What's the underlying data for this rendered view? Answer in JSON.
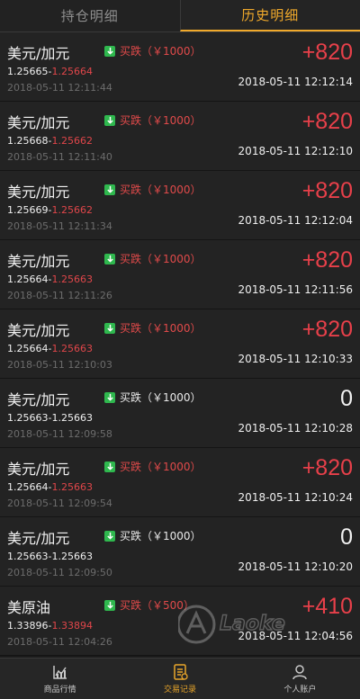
{
  "tabs": [
    {
      "label": "持仓明细",
      "active": false
    },
    {
      "label": "历史明细",
      "active": true
    }
  ],
  "trades": [
    {
      "symbol": "美元/加元",
      "direction": "买跌（￥1000）",
      "open_price": "1.25665",
      "close_price": "1.25664",
      "open_time": "2018-05-11 12:11:44",
      "pnl": "+820",
      "close_time": "2018-05-11 12:12:14",
      "win": true
    },
    {
      "symbol": "美元/加元",
      "direction": "买跌（￥1000）",
      "open_price": "1.25668",
      "close_price": "1.25662",
      "open_time": "2018-05-11 12:11:40",
      "pnl": "+820",
      "close_time": "2018-05-11 12:12:10",
      "win": true
    },
    {
      "symbol": "美元/加元",
      "direction": "买跌（￥1000）",
      "open_price": "1.25669",
      "close_price": "1.25662",
      "open_time": "2018-05-11 12:11:34",
      "pnl": "+820",
      "close_time": "2018-05-11 12:12:04",
      "win": true
    },
    {
      "symbol": "美元/加元",
      "direction": "买跌（￥1000）",
      "open_price": "1.25664",
      "close_price": "1.25663",
      "open_time": "2018-05-11 12:11:26",
      "pnl": "+820",
      "close_time": "2018-05-11 12:11:56",
      "win": true
    },
    {
      "symbol": "美元/加元",
      "direction": "买跌（￥1000）",
      "open_price": "1.25664",
      "close_price": "1.25663",
      "open_time": "2018-05-11 12:10:03",
      "pnl": "+820",
      "close_time": "2018-05-11 12:10:33",
      "win": true
    },
    {
      "symbol": "美元/加元",
      "direction": "买跌（￥1000）",
      "open_price": "1.25663",
      "close_price": "1.25663",
      "open_time": "2018-05-11 12:09:58",
      "pnl": "0",
      "close_time": "2018-05-11 12:10:28",
      "win": false
    },
    {
      "symbol": "美元/加元",
      "direction": "买跌（￥1000）",
      "open_price": "1.25664",
      "close_price": "1.25663",
      "open_time": "2018-05-11 12:09:54",
      "pnl": "+820",
      "close_time": "2018-05-11 12:10:24",
      "win": true
    },
    {
      "symbol": "美元/加元",
      "direction": "买跌（￥1000）",
      "open_price": "1.25663",
      "close_price": "1.25663",
      "open_time": "2018-05-11 12:09:50",
      "pnl": "0",
      "close_time": "2018-05-11 12:10:20",
      "win": false
    },
    {
      "symbol": "美原油",
      "direction": "买跌（￥500）",
      "open_price": "1.33896",
      "close_price": "1.33894",
      "open_time": "2018-05-11 12:04:26",
      "pnl": "+410",
      "close_time": "2018-05-11 12:04:56",
      "win": true
    }
  ],
  "price_separator": "-",
  "watermark": "Laoke",
  "nav": [
    {
      "label": "商品行情",
      "icon": "chart-icon",
      "active": false
    },
    {
      "label": "交易记录",
      "icon": "record-icon",
      "active": true
    },
    {
      "label": "个人账户",
      "icon": "user-icon",
      "active": false
    }
  ],
  "colors": {
    "accent": "#f0a92b",
    "profit": "#e8404a",
    "down_arrow": "#2fb84e",
    "background": "#1b1b1b",
    "row": "#232323"
  }
}
